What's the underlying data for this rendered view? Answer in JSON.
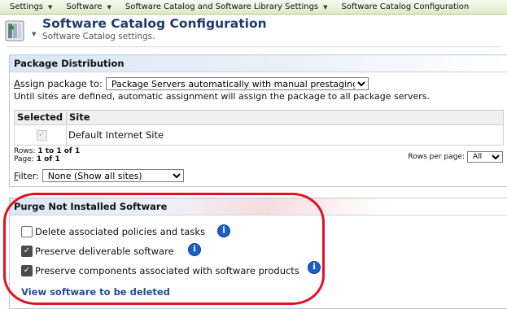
{
  "breadcrumbs": [
    "Settings",
    "Software",
    "Software Catalog and Software Library Settings",
    "Software Catalog Configuration"
  ],
  "header": {
    "title": "Software Catalog Configuration",
    "subtitle": "Software Catalog settings."
  },
  "package_distribution": {
    "heading": "Package Distribution",
    "assign_label": "Assign package to:",
    "assign_value": "Package Servers automatically with manual prestaging",
    "note": "Until sites are defined, automatic assignment will assign the package to all package servers.",
    "columns": [
      "Selected",
      "Site"
    ],
    "rows": [
      {
        "selected": true,
        "site": "Default Internet Site"
      }
    ],
    "rows_info": "1 to 1 of 1",
    "rows_label": "Rows:",
    "page_label": "Page:",
    "page_info": "1 of 1",
    "rows_per_page_label": "Rows per page:",
    "rows_per_page_value": "All",
    "filter_label": "Filter:",
    "filter_value": "None (Show all sites)"
  },
  "purge": {
    "heading": "Purge Not Installed Software",
    "options": [
      {
        "label": "Delete associated policies and tasks",
        "checked": false
      },
      {
        "label": "Preserve deliverable software",
        "checked": true
      },
      {
        "label": "Preserve components associated with software products",
        "checked": true
      }
    ],
    "link": "View software to be deleted"
  },
  "icons": {
    "app": "software-catalog-icon",
    "info": "info-icon",
    "dropdown": "chevron-down-icon"
  },
  "colors": {
    "title": "#1f3c6e",
    "link": "#1f4e95",
    "info": "#1a5fc8",
    "highlight": "#e3101e"
  }
}
